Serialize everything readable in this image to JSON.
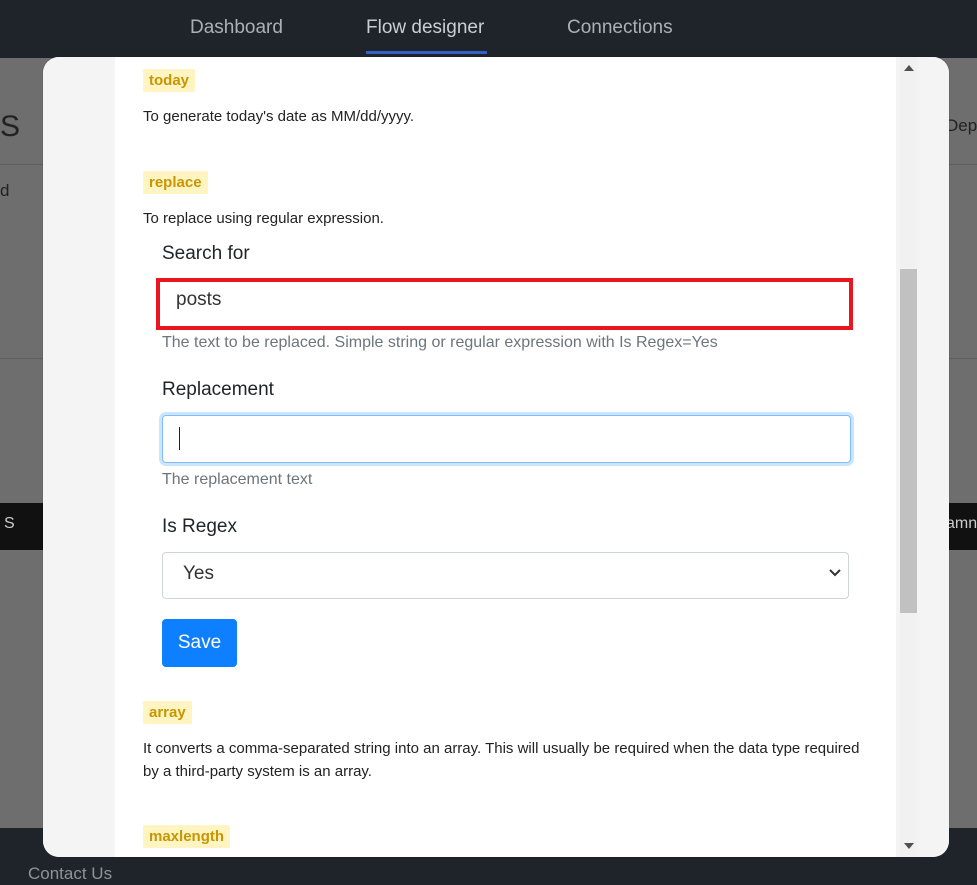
{
  "nav": {
    "dashboard": "Dashboard",
    "flow_designer": "Flow designer",
    "connections": "Connections"
  },
  "footer": {
    "contact": "Contact Us"
  },
  "background": {
    "left_letter": "S",
    "right_text": "Dep",
    "left_small": "d",
    "left_bar": "S",
    "right_bar": "amn"
  },
  "functions": [
    {
      "name": "today",
      "description": "To generate today's date as MM/dd/yyyy."
    },
    {
      "name": "replace",
      "description": "To replace using regular expression."
    },
    {
      "name": "array",
      "description": "It converts a comma-separated string into an array. This will usually be required when the data type required by a third-party system is an array."
    },
    {
      "name": "maxlength"
    }
  ],
  "replace_form": {
    "search_label": "Search for",
    "search_value": "posts",
    "search_help": "The text to be replaced. Simple string or regular expression with Is Regex=Yes",
    "replacement_label": "Replacement",
    "replacement_value": "",
    "replacement_help": "The replacement text",
    "regex_label": "Is Regex",
    "regex_value": "Yes",
    "save_label": "Save"
  },
  "colors": {
    "tag_bg": "#fff4c2",
    "tag_text": "#c79600",
    "highlight": "#e8171f",
    "primary": "#0d7fff"
  }
}
